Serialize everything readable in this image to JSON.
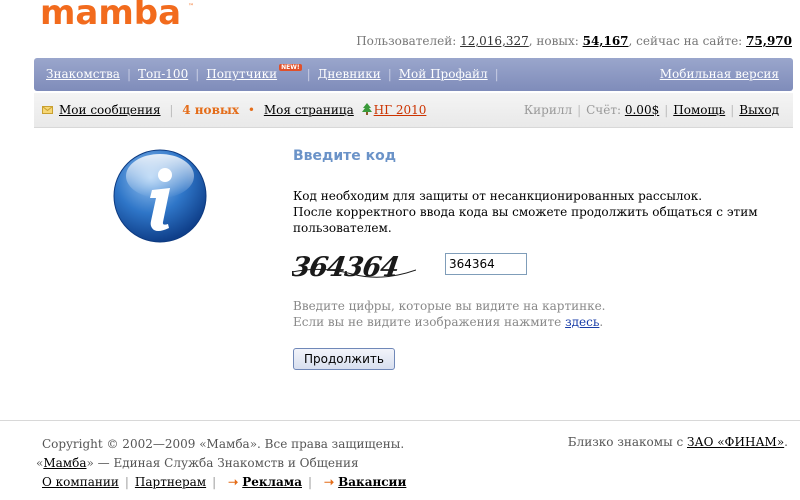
{
  "header": {
    "logo_text": "mamba",
    "stats": {
      "users_label": "Пользователей:",
      "users_value": "12,016,327",
      "new_label": ", новых:",
      "new_value": "54,167",
      "online_label": ", сейчас на сайте:",
      "online_value": "75,970"
    }
  },
  "nav": {
    "items": [
      {
        "label": "Знакомства"
      },
      {
        "label": "Топ-100"
      },
      {
        "label": "Попутчики",
        "badge": "NEW!"
      },
      {
        "label": "Дневники"
      },
      {
        "label": "Мой Профайл"
      }
    ],
    "mobile": "Мобильная версия"
  },
  "subbar": {
    "messages": "Мои сообщения",
    "new_count": "4 новых",
    "my_page": "Моя страница",
    "ng": "НГ 2010",
    "user": "Кирилл",
    "account_label": "Счёт:",
    "account_value": "0.00$",
    "help": "Помощь",
    "logout": "Выход"
  },
  "main": {
    "title": "Введите код",
    "desc_line1": "Код необходим для защиты от несанкционированных рассылок.",
    "desc_line2": "После корректного ввода кода вы сможете продолжить общаться с этим пользователем.",
    "captcha_text": "364364",
    "input_value": "364364",
    "hint_line1": "Введите цифры, которые вы видите на картинке.",
    "hint_line2_prefix": "Если вы не видите изображения нажмите",
    "hint_link": "здесь",
    "hint_suffix": ".",
    "button": "Продолжить"
  },
  "footer": {
    "copyright": "Copyright © 2002—2009 «Мамба». Все права защищены.",
    "tagline_open": "«",
    "tagline_link": "Мамба",
    "tagline_rest": "» — Единая Служба Знакомств и Общения",
    "links": [
      "О компании",
      "Партнерам",
      "Реклама",
      "Вакансии"
    ],
    "finam_prefix": "Близко знакомы с",
    "finam_link": "ЗАО «ФИНАМ»",
    "finam_suffix": "."
  },
  "colors": {
    "nav_bg": "#8792c2",
    "title": "#6b93c8",
    "accent_orange": "#e46d1a"
  }
}
